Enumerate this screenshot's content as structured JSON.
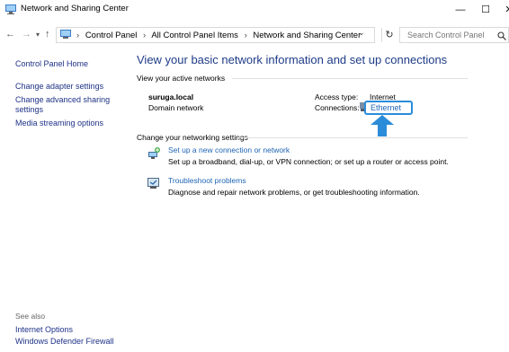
{
  "window": {
    "title": "Network and Sharing Center",
    "minimize": "—",
    "maximize": "☐",
    "close": "✕"
  },
  "nav": {
    "back": "←",
    "forward": "→",
    "recent": "▾",
    "up": "↑"
  },
  "address": {
    "crumbs": [
      "Control Panel",
      "All Control Panel Items",
      "Network and Sharing Center"
    ],
    "separator": "›",
    "dropdown": "⌄",
    "refresh": "↻"
  },
  "search": {
    "placeholder": "Search Control Panel",
    "icon": "search-icon"
  },
  "sidebar": {
    "home": "Control Panel Home",
    "items": [
      "Change adapter settings",
      "Change advanced sharing settings",
      "Media streaming options"
    ],
    "see_also_label": "See also",
    "see_also": [
      "Internet Options",
      "Windows Defender Firewall"
    ]
  },
  "main": {
    "title": "View your basic network information and set up connections",
    "active_networks_label": "View your active networks",
    "network": {
      "name": "suruga.local",
      "type": "Domain network",
      "access_type_label": "Access type:",
      "access_type_value": "Internet",
      "connections_label": "Connections:",
      "connection_name": "Ethernet"
    },
    "settings_label": "Change your networking settings",
    "tasks": [
      {
        "icon": "new-connection-icon",
        "title": "Set up a new connection or network",
        "desc": "Set up a broadband, dial-up, or VPN connection; or set up a router or access point."
      },
      {
        "icon": "troubleshoot-icon",
        "title": "Troubleshoot problems",
        "desc": "Diagnose and repair network problems, or get troubleshooting information."
      }
    ]
  },
  "colors": {
    "link": "#1e64b4",
    "title": "#1e3c87",
    "highlight": "#2b8cd9"
  }
}
